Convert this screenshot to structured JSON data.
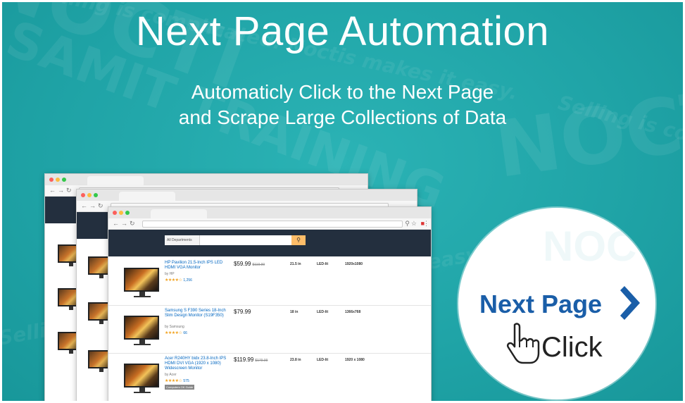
{
  "headline": "Next Page Automation",
  "subtitle": {
    "line1": "Automaticly Click to the Next Page",
    "line2": "and Scrape Large Collections of Data"
  },
  "colors": {
    "background": "#1fa3a6",
    "amazon_header": "#232f3e",
    "next_page_blue": "#1a5ea8"
  },
  "browser": {
    "search_dept": "All Departments"
  },
  "products": [
    {
      "title": "HP Pavilion 21.5-Inch IPS LED HDMI VGA Monitor",
      "brand": "by HP",
      "price": "$59.99",
      "list_price": "$119.99",
      "reviews": "1,256",
      "size": "21.5 in",
      "type": "LED-lit",
      "resolution": "1920x1080"
    },
    {
      "title": "Samsung S F390 Series 18-Inch Slim Design Monitor (S19F350)",
      "brand": "by Samsung",
      "price": "$79.99",
      "list_price": "",
      "reviews": "66",
      "size": "18 in",
      "type": "LED-lit",
      "resolution": "1366x768"
    },
    {
      "title": "Acer R240HY bidx 23.8-Inch IPS HDMI DVI VGA (1920 x 1080) Widescreen Monitor",
      "brand": "by Acer",
      "price": "$119.99",
      "list_price": "$179.99",
      "reviews": "575",
      "size": "23.8 in",
      "type": "LED-lit",
      "resolution": "1920 x 1080",
      "tag": "Computers OK Guide"
    }
  ],
  "callout": {
    "next_page": "Next Page",
    "click": "Click",
    "chevron_icon": "chevron-right-icon",
    "hand_icon": "hand-pointer-icon"
  },
  "watermark": {
    "big1": "NOCTI",
    "big2": "SAMIT TRAINING",
    "tagline": "Selling is complicated. Noctis makes it easy."
  }
}
